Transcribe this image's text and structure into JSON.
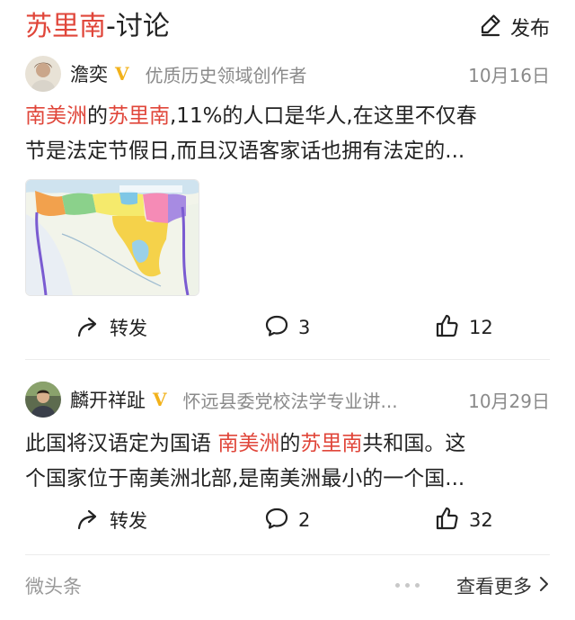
{
  "header": {
    "title_highlight": "苏里南",
    "title_rest": "-讨论",
    "publish_label": "发布"
  },
  "posts": [
    {
      "author": "澹奕",
      "verified": "V",
      "desc": "优质历史领域创作者",
      "date": "10月16日",
      "line1": [
        {
          "text": "南美洲",
          "hl": true
        },
        {
          "text": "的",
          "hl": false
        },
        {
          "text": "苏里南",
          "hl": true
        },
        {
          "text": ",11%的人口是华人,在这里不仅春",
          "hl": false
        }
      ],
      "line2": "节是法定节假日,而且汉语客家话也拥有法定的...",
      "actions": {
        "share": "转发",
        "comments": "3",
        "likes": "12"
      }
    },
    {
      "author": "麟开祥趾",
      "verified": "V",
      "desc": "怀远县委党校法学专业讲...",
      "date": "10月29日",
      "line1": [
        {
          "text": "此国将汉语定为国语 ",
          "hl": false
        },
        {
          "text": "南美洲",
          "hl": true
        },
        {
          "text": "的",
          "hl": false
        },
        {
          "text": "苏里南",
          "hl": true
        },
        {
          "text": "共和国。这",
          "hl": false
        }
      ],
      "line2": "个国家位于南美洲北部,是南美洲最小的一个国...",
      "actions": {
        "share": "转发",
        "comments": "2",
        "likes": "32"
      }
    }
  ],
  "footer": {
    "source": "微头条",
    "more": "查看更多"
  },
  "colors": {
    "highlight": "#e0463a",
    "verified": "#f2b21b",
    "muted": "#8a8a8a"
  },
  "icons": [
    "edit-icon",
    "share-icon",
    "comment-icon",
    "like-icon",
    "chevron-right-icon"
  ]
}
